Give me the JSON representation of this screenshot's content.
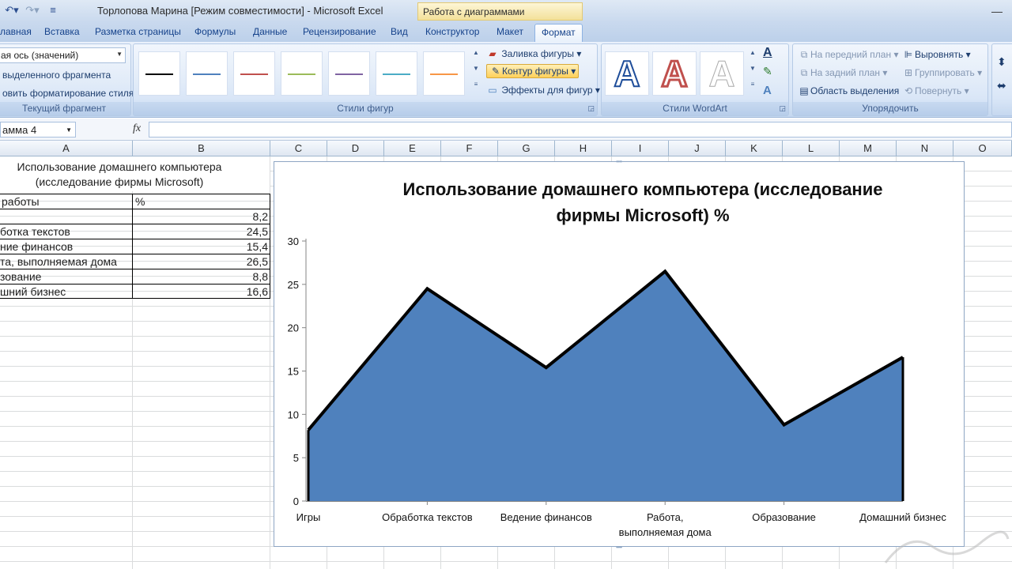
{
  "window": {
    "title": "Торлопова Марина  [Режим совместимости] - Microsoft Excel",
    "context_title": "Работа с диаграммами"
  },
  "tabs": [
    "лавная",
    "Вставка",
    "Разметка страницы",
    "Формулы",
    "Данные",
    "Рецензирование",
    "Вид"
  ],
  "context_tabs": [
    "Конструктор",
    "Макет",
    "Формат"
  ],
  "active_tab": "Формат",
  "ribbon": {
    "current_fragment": {
      "combo_value": "ая ось (значений)",
      "format_selection": "выделенного фрагмента",
      "reset_style": "овить форматирование стиля",
      "label": "Текущий фрагмент"
    },
    "shape_styles": {
      "swatch_colors": [
        "#000000",
        "#4f81bd",
        "#c0504d",
        "#9bbb59",
        "#8064a2",
        "#4bacc6",
        "#f79646"
      ],
      "fill": "Заливка фигуры",
      "outline": "Контур фигуры",
      "effects": "Эффекты для фигур",
      "label": "Стили фигур"
    },
    "wordart": {
      "glyph": "A",
      "label": "Стили WordArt"
    },
    "arrange": {
      "bring_front": "На передний план",
      "send_back": "На задний план",
      "selection_pane": "Область выделения",
      "align": "Выровнять",
      "group": "Группировать",
      "rotate": "Повернуть",
      "label": "Упорядочить"
    }
  },
  "formula_bar": {
    "name_box": "амма 4",
    "fx": "fx",
    "formula": ""
  },
  "columns": [
    "A",
    "B",
    "C",
    "D",
    "E",
    "F",
    "G",
    "H",
    "I",
    "J",
    "K",
    "L",
    "M",
    "N",
    "O"
  ],
  "sheet": {
    "title_line1": "Использование домашнего компьютера",
    "title_line2": "(исследование фирмы Microsoft)",
    "header": [
      "работы",
      "%"
    ],
    "rows": [
      {
        "label": "",
        "value": "8,2"
      },
      {
        "label": "ботка текстов",
        "value": "24,5"
      },
      {
        "label": "ние финансов",
        "value": "15,4"
      },
      {
        "label": "та, выполняемая дома",
        "value": "26,5"
      },
      {
        "label": "зование",
        "value": "8,8"
      },
      {
        "label": "шний бизнес",
        "value": "16,6"
      }
    ]
  },
  "chart_data": {
    "type": "area",
    "title": "Использование домашнего компьютера (исследование фирмы Microsoft) %",
    "title_line1": "Использование домашнего компьютера (исследование",
    "title_line2": "фирмы Microsoft) %",
    "categories": [
      "Игры",
      "Обработка текстов",
      "Ведение финансов",
      "Работа, выполняемая дома",
      "Образование",
      "Домашний бизнес"
    ],
    "category_lines": [
      [
        "Игры"
      ],
      [
        "Обработка текстов"
      ],
      [
        "Ведение финансов"
      ],
      [
        "Работа,",
        "выполняемая дома"
      ],
      [
        "Образование"
      ],
      [
        "Домашний бизнес"
      ]
    ],
    "values": [
      8.2,
      24.5,
      15.4,
      26.5,
      8.8,
      16.6
    ],
    "ylim": [
      0,
      30
    ],
    "yticks": [
      0,
      5,
      10,
      15,
      20,
      25,
      30
    ],
    "fill_color": "#4f81bd",
    "line_color": "#000000",
    "grid": false,
    "legend": "none"
  }
}
